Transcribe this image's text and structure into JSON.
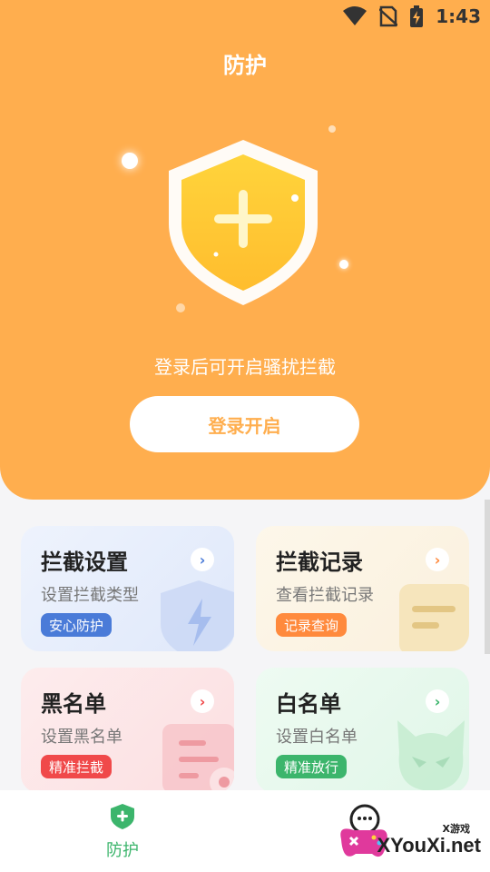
{
  "status_bar": {
    "time": "1:43"
  },
  "header": {
    "title": "防护"
  },
  "hero": {
    "tip": "登录后可开启骚扰拦截",
    "login_button": "登录开启"
  },
  "cards": [
    {
      "title": "拦截设置",
      "subtitle": "设置拦截类型",
      "badge": "安心防护",
      "arrow": "›",
      "accent": "#4a7bd8",
      "bg": "#e7edfb"
    },
    {
      "title": "拦截记录",
      "subtitle": "查看拦截记录",
      "badge": "记录查询",
      "arrow": "›",
      "accent": "#ff8a3d",
      "bg": "#fdf4e3"
    },
    {
      "title": "黑名单",
      "subtitle": "设置黑名单",
      "badge": "精准拦截",
      "arrow": "›",
      "accent": "#f0494a",
      "bg": "#fde6e7"
    },
    {
      "title": "白名单",
      "subtitle": "设置白名单",
      "badge": "精准放行",
      "arrow": "›",
      "accent": "#3cb56c",
      "bg": "#e4f8ec"
    }
  ],
  "bottom_nav": {
    "items": [
      {
        "label": "防护",
        "icon": "shield-plus-icon",
        "active": true
      }
    ]
  },
  "watermark": {
    "text": "XYouXi.net",
    "small": "X游戏"
  },
  "colors": {
    "brand": "#ffae4e",
    "active_tab": "#3cb56c"
  }
}
